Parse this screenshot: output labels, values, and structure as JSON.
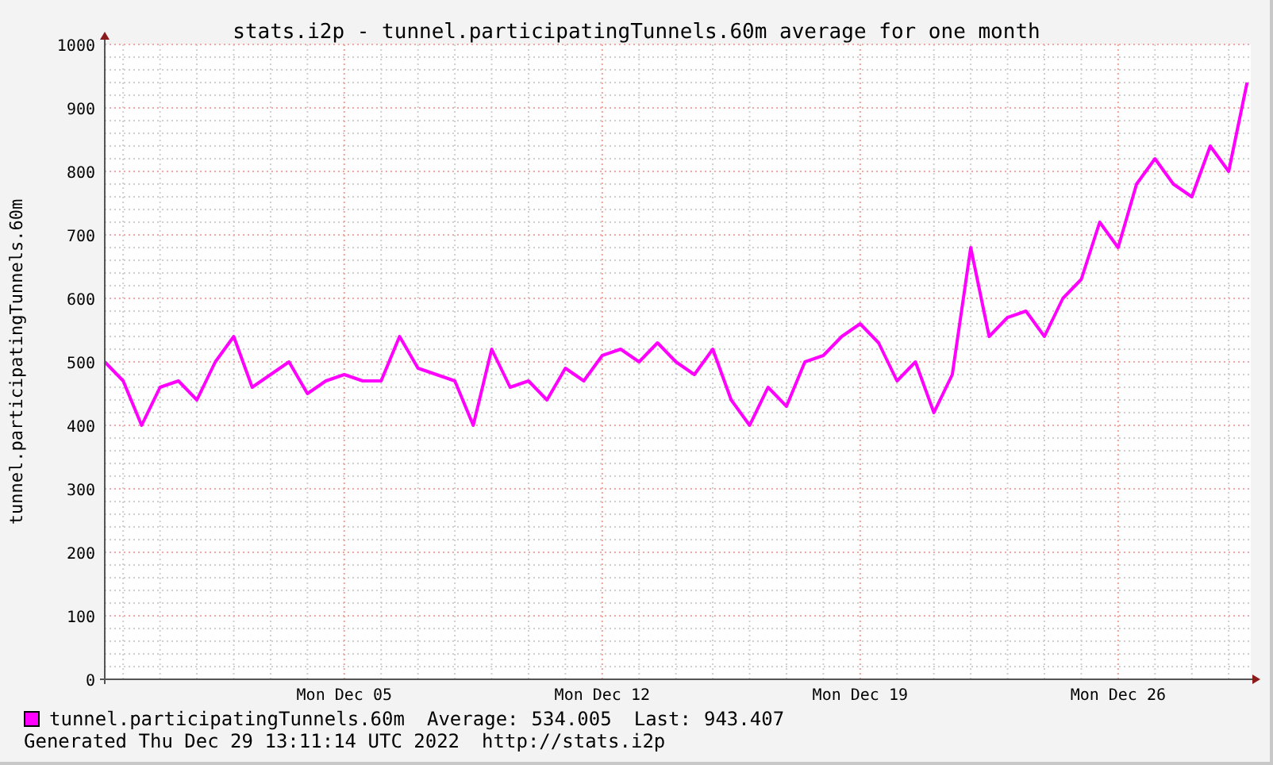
{
  "chart": {
    "chart_data": {
      "type": "line",
      "title": "stats.i2p - tunnel.participatingTunnels.60m average for one month",
      "ylabel": "tunnel.participatingTunnels.60m",
      "categories": [
        null,
        null,
        null,
        null,
        null,
        null,
        null,
        null,
        null,
        null,
        null,
        null,
        null,
        "Mon Dec 05",
        null,
        null,
        null,
        null,
        null,
        null,
        null,
        null,
        null,
        null,
        null,
        null,
        null,
        "Mon Dec 12",
        null,
        null,
        null,
        null,
        null,
        null,
        null,
        null,
        null,
        null,
        null,
        null,
        null,
        "Mon Dec 19",
        null,
        null,
        null,
        null,
        null,
        null,
        null,
        null,
        null,
        null,
        null,
        null,
        null,
        "Mon Dec 26",
        null,
        null,
        null,
        null,
        null,
        null,
        null
      ],
      "series": [
        {
          "name": "tunnel.participatingTunnels.60m",
          "color": "#ff00ff",
          "values": [
            500,
            470,
            400,
            460,
            470,
            440,
            500,
            540,
            460,
            480,
            500,
            450,
            470,
            480,
            470,
            470,
            540,
            490,
            480,
            470,
            400,
            520,
            460,
            470,
            440,
            490,
            470,
            510,
            520,
            500,
            530,
            500,
            480,
            520,
            440,
            400,
            460,
            430,
            500,
            510,
            540,
            560,
            530,
            470,
            500,
            420,
            480,
            680,
            540,
            570,
            580,
            540,
            600,
            630,
            720,
            680,
            780,
            820,
            780,
            760,
            840,
            800,
            940
          ]
        }
      ],
      "ylim": [
        0,
        1000
      ],
      "grid": true,
      "yticks": [
        0,
        100,
        200,
        300,
        400,
        500,
        600,
        700,
        800,
        900,
        1000
      ]
    }
  },
  "legend": [
    {
      "average_label": "Average:",
      "average": "534.005",
      "last_label": "Last:",
      "last": "943.407"
    }
  ],
  "footer": {
    "generated": "Generated Thu Dec 29 13:11:14 UTC 2022",
    "url": "http://stats.i2p"
  }
}
